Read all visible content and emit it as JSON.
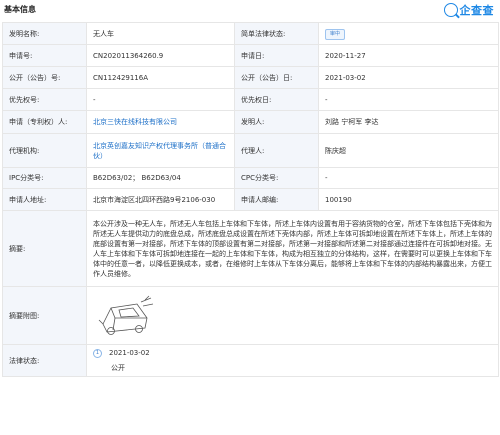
{
  "header": {
    "title": "基本信息",
    "brand": "企查查"
  },
  "rows": {
    "invention_name_label": "发明名称:",
    "invention_name": "无人车",
    "legal_status_label": "简单法律状态:",
    "legal_status_badge": "审中",
    "app_no_label": "申请号:",
    "app_no": "CN202011364260.9",
    "app_date_label": "申请日:",
    "app_date": "2020-11-27",
    "pub_no_label": "公开（公告）号:",
    "pub_no": "CN112429116A",
    "pub_date_label": "公开（公告）日:",
    "pub_date": "2021-03-02",
    "priority_no_label": "优先权号:",
    "priority_no": "-",
    "priority_date_label": "优先权日:",
    "priority_date": "-",
    "applicant_label": "申请（专利权）人:",
    "applicant": "北京三快在线科技有限公司",
    "inventor_label": "发明人:",
    "inventor": "刘路 宁柯军 李达",
    "agency_label": "代理机构:",
    "agency": "北京英创嘉友知识产权代理事务所（普通合伙）",
    "agent_label": "代理人:",
    "agent": "陈庆超",
    "ipc_label": "IPC分类号:",
    "ipc": "B62D63/02； B62D63/04",
    "cpc_label": "CPC分类号:",
    "cpc": "-",
    "address_label": "申请人地址:",
    "address": "北京市海淀区北四环西路9号2106-030",
    "postcode_label": "申请人邮编:",
    "postcode": "100190",
    "abstract_label": "摘要:",
    "abstract": "本公开涉及一种无人车，所述无人车包括上车体和下车体，所述上车体内设置有用于容纳货物的仓室，所述下车体包括下壳体和为所述无人车提供动力的底盘总成，所述底盘总成设置在所述下壳体内部，所述上车体可拆卸地设置在所述下车体上，所述上车体的底部设置有第一对接部，所述下车体的顶部设置有第二对接部，所述第一对接部和所述第二对接部通过连接件在可拆卸地对接。无人车上车体和下车体可拆卸地连接在一起的上车体和下车体，构成为相互独立的分体结构，这样，在需要时可以更换上车体和下车体中的任意一者，以降低更换成本，或者，在维修时上车体从下车体分离后，能够将上车体和下车体的内部结构暴露出来，方便工作人员维修。",
    "figure_label": "摘要附图:",
    "status_label": "法律状态:",
    "status_step": "1",
    "status_date": "2021-03-02",
    "status_text": "公开"
  },
  "colors": {
    "accent": "#1e88e5",
    "link": "#1e70c8",
    "label_bg": "#f3f6fb"
  }
}
